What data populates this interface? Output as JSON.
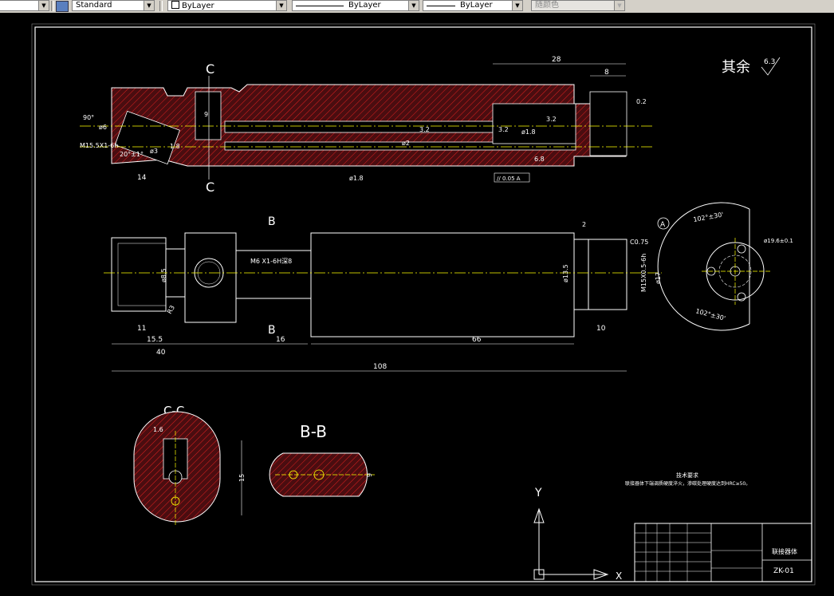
{
  "toolbar": {
    "text_style": "Standard",
    "layer_color": "ByLayer",
    "linetype": "ByLayer",
    "lineweight": "ByLayer",
    "plot_style": "随颜色"
  },
  "drawing": {
    "title_part": "联接器体",
    "drawing_no": "ZK-01",
    "tech_req_title": "技术要求",
    "tech_req_text": "联接器体下端调质硬度淬火，渗碳处理硬度达到HRC≥50。",
    "roughness_note": "其余",
    "roughness_default": "6.3",
    "section_cc": "C-C",
    "section_bb": "B-B",
    "cut_c": "C",
    "cut_b": "B",
    "datum_a": "A",
    "axis_y": "Y",
    "axis_x": "X",
    "dims": {
      "d28": "28",
      "d8": "8",
      "d02": "0.2",
      "d32a": "3.2",
      "d32b": "3.2",
      "d32c": "3.2",
      "d18a": "ø1.8",
      "d18b": "ø1.8",
      "d2": "ø2",
      "d68": "6.8",
      "d9": "9",
      "d6": "ø6",
      "d90": "90°",
      "m15": "M15.5X1-6h",
      "d14": "14",
      "d20": "20°±1°",
      "d3": "ø3",
      "d18c": "1.8",
      "tol1": "// 0.05 A",
      "m6": "M6 X1-6H深8",
      "d11": "11",
      "d155": "15.5",
      "d40": "40",
      "d16": "16",
      "d66": "66",
      "d10": "10",
      "d108": "108",
      "d2b": "2",
      "c075": "C0.75",
      "m15b": "M15X0.5-6h",
      "d17": "ø17",
      "d135": "ø13.5",
      "d85": "ø8.5",
      "r3": "R3",
      "ang1": "102°±30'",
      "ang2": "102°±30'",
      "d19": "ø19.6±0.1",
      "d16b": "1.6",
      "d15": "15",
      "d9b": "9"
    }
  }
}
